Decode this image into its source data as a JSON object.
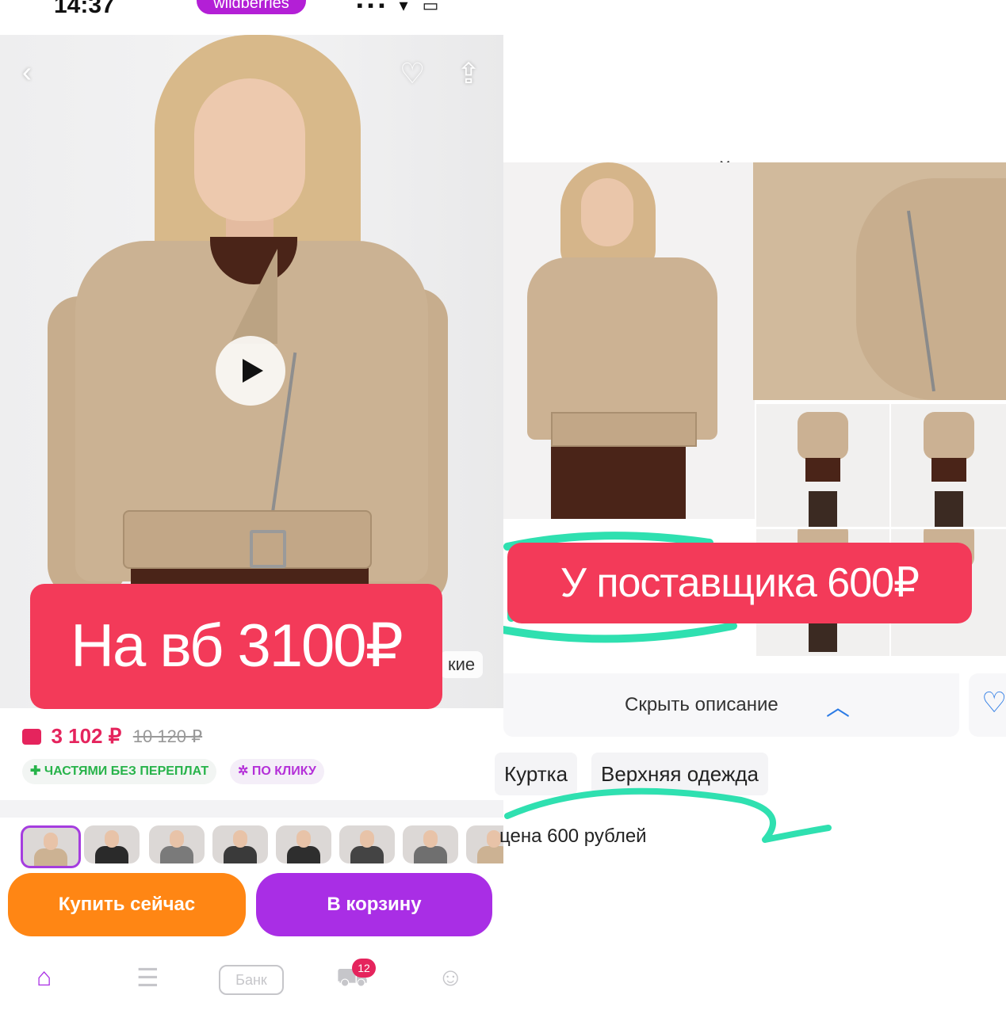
{
  "left_app": {
    "status_bar": {
      "time": "14:37",
      "pill_text": "wildberries"
    },
    "product": {
      "price_current": "3 102 ₽",
      "price_old": "10 120 ₽",
      "badge_installments": "ЧАСТЯМИ БЕЗ ПЕРЕПЛАТ",
      "badge_oneclick": "ПО КЛИКУ",
      "partial_chip": "кие"
    },
    "overlay_label": "На вб 3100₽",
    "thumbnails_count": 8,
    "buttons": {
      "buy_now": "Купить сейчас",
      "to_cart": "В корзину"
    },
    "navbar": {
      "bank": "Банк",
      "cart_badge": "12"
    }
  },
  "right_app": {
    "overlay_label": "У поставщика 600₽",
    "description_toggle": "Скрыть описание",
    "tags": [
      "Куртка",
      "Верхняя одежда"
    ],
    "price_note": "цена 600 рублей"
  },
  "colors": {
    "overlay_red": "#f33a59",
    "price_pink": "#e5245d",
    "buy_orange": "#ff8614",
    "cart_purple": "#a92ee5",
    "highlight_green": "#2fe0b0",
    "link_blue": "#2c7be5"
  },
  "icons": [
    "back-icon",
    "heart-icon",
    "share-icon",
    "play-icon",
    "home-icon",
    "catalog-icon",
    "cart-icon",
    "profile-icon",
    "chevron-up-icon",
    "close-icon"
  ]
}
